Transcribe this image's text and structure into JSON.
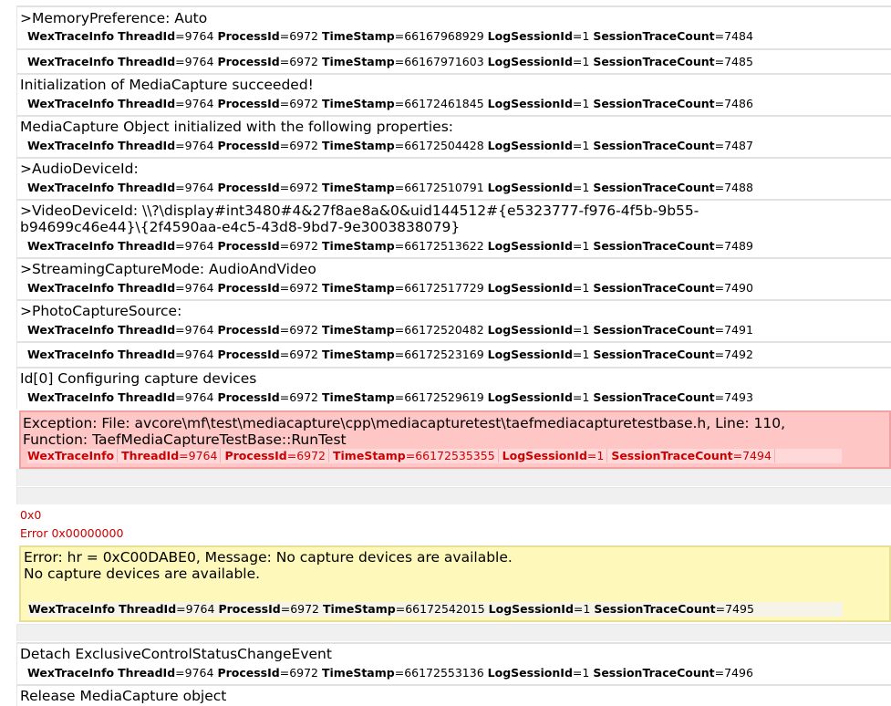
{
  "entries": [
    {
      "kind": "normal",
      "message": ">MemoryPreference: Auto",
      "trace": {
        "label": "WexTraceInfo",
        "thread": "9764",
        "process": "6972",
        "timestamp": "66167968929",
        "session": "1",
        "count": "7484"
      }
    },
    {
      "kind": "normal",
      "message": "",
      "trace": {
        "label": "WexTraceInfo",
        "thread": "9764",
        "process": "6972",
        "timestamp": "66167971603",
        "session": "1",
        "count": "7485"
      }
    },
    {
      "kind": "normal",
      "message": "Initialization of MediaCapture succeeded!",
      "trace": {
        "label": "WexTraceInfo",
        "thread": "9764",
        "process": "6972",
        "timestamp": "66172461845",
        "session": "1",
        "count": "7486"
      }
    },
    {
      "kind": "normal",
      "message": "MediaCapture Object initialized with the following properties:",
      "trace": {
        "label": "WexTraceInfo",
        "thread": "9764",
        "process": "6972",
        "timestamp": "66172504428",
        "session": "1",
        "count": "7487"
      }
    },
    {
      "kind": "normal",
      "message": ">AudioDeviceId:",
      "trace": {
        "label": "WexTraceInfo",
        "thread": "9764",
        "process": "6972",
        "timestamp": "66172510791",
        "session": "1",
        "count": "7488"
      }
    },
    {
      "kind": "normal",
      "message": ">VideoDeviceId: \\\\?\\display#int3480#4&27f8ae8a&0&uid144512#{e5323777-f976-4f5b-9b55-\nb94699c46e44}\\{2f4590aa-e4c5-43d8-9bd7-9e3003838079}",
      "trace": {
        "label": "WexTraceInfo",
        "thread": "9764",
        "process": "6972",
        "timestamp": "66172513622",
        "session": "1",
        "count": "7489"
      }
    },
    {
      "kind": "normal",
      "message": ">StreamingCaptureMode: AudioAndVideo",
      "trace": {
        "label": "WexTraceInfo",
        "thread": "9764",
        "process": "6972",
        "timestamp": "66172517729",
        "session": "1",
        "count": "7490"
      }
    },
    {
      "kind": "normal",
      "message": ">PhotoCaptureSource:",
      "trace": {
        "label": "WexTraceInfo",
        "thread": "9764",
        "process": "6972",
        "timestamp": "66172520482",
        "session": "1",
        "count": "7491"
      }
    },
    {
      "kind": "normal",
      "message": "",
      "trace": {
        "label": "WexTraceInfo",
        "thread": "9764",
        "process": "6972",
        "timestamp": "66172523169",
        "session": "1",
        "count": "7492"
      }
    },
    {
      "kind": "normal",
      "message": "Id[0] Configuring capture devices",
      "trace": {
        "label": "WexTraceInfo",
        "thread": "9764",
        "process": "6972",
        "timestamp": "66172529619",
        "session": "1",
        "count": "7493"
      }
    },
    {
      "kind": "error",
      "message": "Exception: File: avcore\\mf\\test\\mediacapture\\cpp\\mediacapturetest\\taefmediacapturetestbase.h, Line: 110,\nFunction: TaefMediaCaptureTestBase::RunTest",
      "trace": {
        "label": "WexTraceInfo",
        "thread": "9764",
        "process": "6972",
        "timestamp": "66172535355",
        "session": "1",
        "count": "7494"
      }
    },
    {
      "kind": "warn",
      "message": "Error: hr = 0xC00DABE0, Message: No capture devices are available.\nNo capture devices are available.",
      "trace": {
        "label": "WexTraceInfo",
        "thread": "9764",
        "process": "6972",
        "timestamp": "66172542015",
        "session": "1",
        "count": "7495"
      }
    },
    {
      "kind": "normal",
      "message": "Detach ExclusiveControlStatusChangeEvent",
      "trace": {
        "label": "WexTraceInfo",
        "thread": "9764",
        "process": "6972",
        "timestamp": "66172553136",
        "session": "1",
        "count": "7496"
      }
    },
    {
      "kind": "normal",
      "message": "Release MediaCapture object",
      "trace": null
    }
  ],
  "plain_lines": [
    "0x0",
    "Error 0x00000000"
  ],
  "field_names": {
    "thread": "ThreadId",
    "process": "ProcessId",
    "timestamp": "TimeStamp",
    "session": "LogSessionId",
    "count": "SessionTraceCount"
  },
  "colors": {
    "error_bg": "#ffc6c6",
    "error_text": "#cc0000",
    "warn_bg": "#fff8bb"
  }
}
